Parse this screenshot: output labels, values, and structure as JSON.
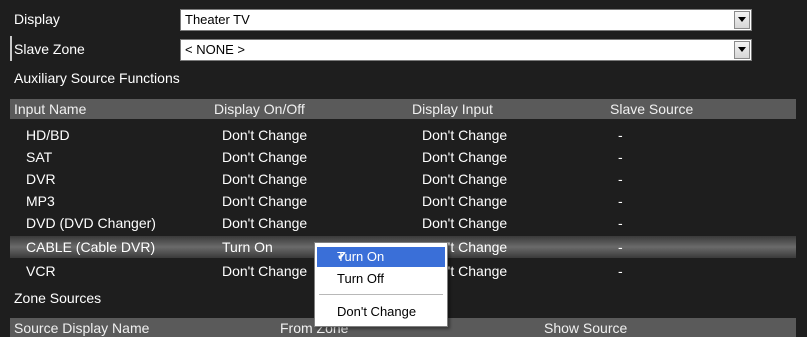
{
  "display": {
    "label": "Display",
    "value": "Theater TV"
  },
  "slave_zone": {
    "label": "Slave Zone",
    "value": "< NONE >"
  },
  "aux": {
    "title": "Auxiliary Source Functions",
    "headers": [
      "Input Name",
      "Display On/Off",
      "Display Input",
      "Slave Source"
    ],
    "rows": [
      {
        "name": "HD/BD",
        "onoff": "Don't Change",
        "input": "Don't Change",
        "slave": "-"
      },
      {
        "name": "SAT",
        "onoff": "Don't Change",
        "input": "Don't Change",
        "slave": "-"
      },
      {
        "name": "DVR",
        "onoff": "Don't Change",
        "input": "Don't Change",
        "slave": "-"
      },
      {
        "name": "MP3",
        "onoff": "Don't Change",
        "input": "Don't Change",
        "slave": "-"
      },
      {
        "name": "DVD (DVD Changer)",
        "onoff": "Don't Change",
        "input": "Don't Change",
        "slave": "-"
      },
      {
        "name": "CABLE (Cable DVR)",
        "onoff": "Turn On",
        "input": "Don't Change",
        "slave": "-"
      },
      {
        "name": "VCR",
        "onoff": "Don't Change",
        "input": "Don't Change",
        "slave": "-"
      }
    ]
  },
  "zone": {
    "title": "Zone Sources",
    "headers": [
      "Source Display Name",
      "From Zone",
      "Show Source"
    ]
  },
  "menu": {
    "items": [
      {
        "label": "Turn On",
        "checked": true,
        "highlighted": true
      },
      {
        "label": "Turn Off",
        "checked": false,
        "highlighted": false
      },
      {
        "label": "Don't Change",
        "checked": false,
        "highlighted": false
      }
    ]
  },
  "colors": {
    "background": "#1e1e1e",
    "header_bar": "#5a5a5a",
    "menu_highlight": "#3a6fd8"
  },
  "icons": {
    "dropdown": "triangle-down-icon",
    "check": "checkmark-icon"
  }
}
